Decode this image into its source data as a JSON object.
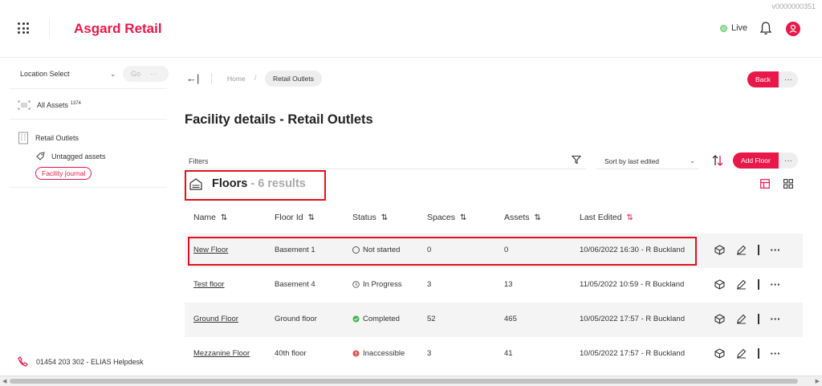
{
  "version": "v0000000351",
  "app": {
    "brand": "Asgard Retail",
    "live_label": "Live"
  },
  "sidebar": {
    "location_select": "Location Select",
    "go_label": "Go",
    "go_more": "···",
    "all_assets_label": "All Assets",
    "all_assets_count": "1374",
    "location_name": "Retail Outlets",
    "untagged_label": "Untagged assets",
    "journal_label": "Facility journal",
    "helpdesk": "01454 203 302 - ELIAS Helpdesk"
  },
  "breadcrumb": {
    "back_arrow": "←|",
    "home": "Home",
    "separator": "/",
    "current": "Retail Outlets"
  },
  "header": {
    "back_label": "Back",
    "more_label": "···",
    "page_title": "Facility details - Retail Outlets"
  },
  "toolbar": {
    "filters_label": "Filters",
    "sort_label": "Sort by last edited",
    "add_floor_label": "Add Floor",
    "add_floor_more": "···"
  },
  "floors": {
    "heading": "Floors",
    "results": "- 6 results"
  },
  "table": {
    "columns": [
      "Name",
      "Floor Id",
      "Status",
      "Spaces",
      "Assets",
      "Last Edited"
    ],
    "rows": [
      {
        "name": "New Floor",
        "floor_id": "Basement 1",
        "status": "Not started",
        "status_icon": "empty-circle-icon",
        "spaces": "0",
        "assets": "0",
        "last_edited": "10/06/2022 16:30 - R Buckland"
      },
      {
        "name": "Test floor",
        "floor_id": "Basement 4",
        "status": "In Progress",
        "status_icon": "clock-icon",
        "spaces": "3",
        "assets": "13",
        "last_edited": "11/05/2022 10:59 - R Buckland"
      },
      {
        "name": "Ground Floor",
        "floor_id": "Ground floor",
        "status": "Completed",
        "status_icon": "check-circle-icon",
        "spaces": "52",
        "assets": "465",
        "last_edited": "10/05/2022 17:57 - R Buckland"
      },
      {
        "name": "Mezzanine Floor",
        "floor_id": "40th floor",
        "status": "Inaccessible",
        "status_icon": "blocked-circle-icon",
        "spaces": "3",
        "assets": "41",
        "last_edited": "10/05/2022 17:57 - R Buckland"
      }
    ],
    "row_more": "···"
  },
  "colors": {
    "accent": "#e8184b",
    "highlight_box": "#e0101e",
    "completed": "#3bb54a",
    "inaccessible": "#d9534f",
    "live": "#6cc46c"
  }
}
